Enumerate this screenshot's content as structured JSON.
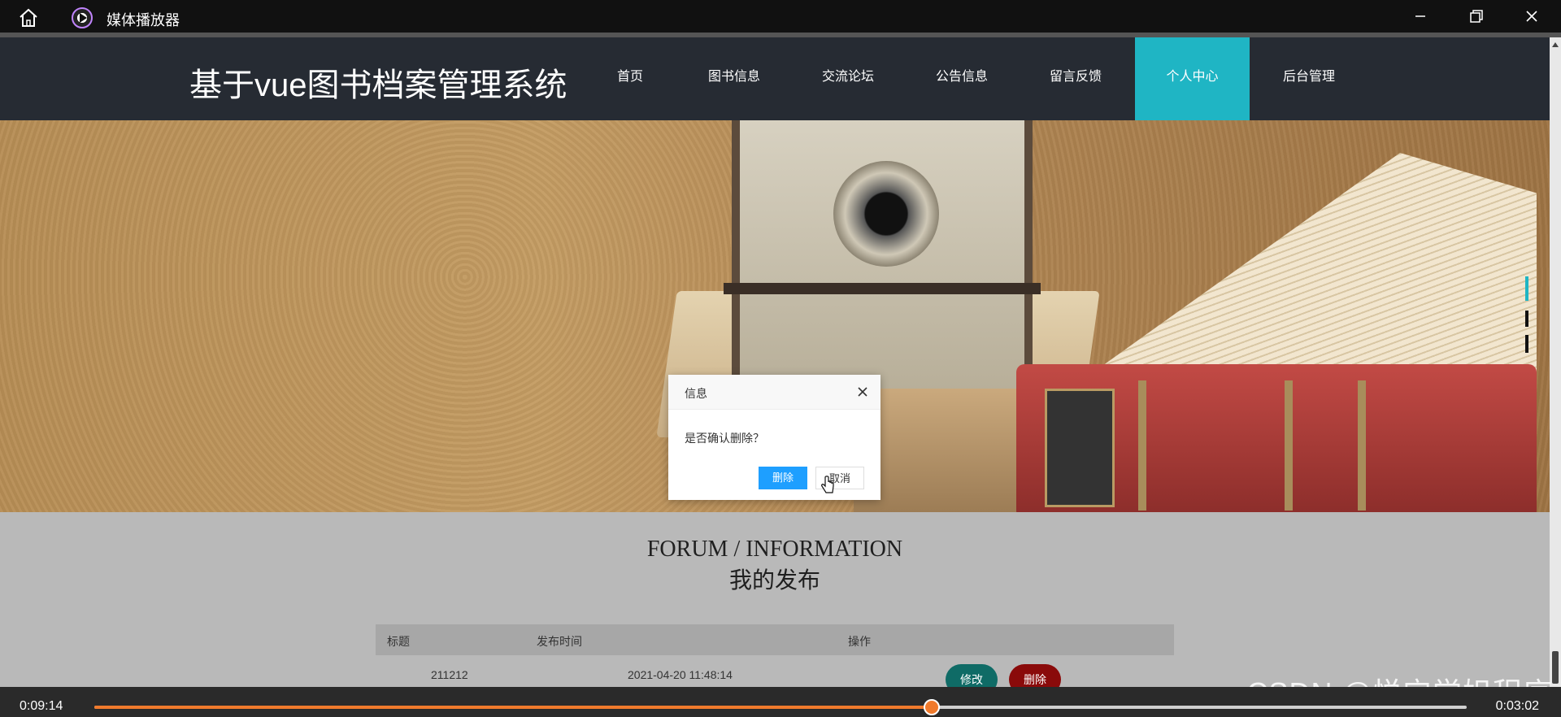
{
  "window": {
    "app_title": "媒体播放器",
    "icons": [
      "home-icon",
      "media-player-icon",
      "minimize-icon",
      "restore-icon",
      "close-icon"
    ]
  },
  "site": {
    "title": "基于vue图书档案管理系统",
    "nav": [
      {
        "label": "首页",
        "active": false
      },
      {
        "label": "图书信息",
        "active": false
      },
      {
        "label": "交流论坛",
        "active": false
      },
      {
        "label": "公告信息",
        "active": false
      },
      {
        "label": "留言反馈",
        "active": false
      },
      {
        "label": "个人中心",
        "active": true
      },
      {
        "label": "后台管理",
        "active": false
      }
    ],
    "accent_color": "#1fb5c4"
  },
  "section": {
    "en_title": "FORUM / INFORMATION",
    "cn_title": "我的发布"
  },
  "table": {
    "headers": [
      "标题",
      "发布时间",
      "操作"
    ],
    "rows": [
      {
        "title": "211212",
        "time": "2021-04-20 11:48:14",
        "edit_label": "修改",
        "delete_label": "删除"
      }
    ]
  },
  "dialog": {
    "title": "信息",
    "message": "是否确认删除？",
    "confirm_label": "删除",
    "cancel_label": "取消"
  },
  "player": {
    "elapsed": "0:09:14",
    "remaining": "0:03:02",
    "progress_fraction": 0.61,
    "accent_color": "#f07a2c"
  },
  "watermark": "CSDN @悦宁学姐程序"
}
